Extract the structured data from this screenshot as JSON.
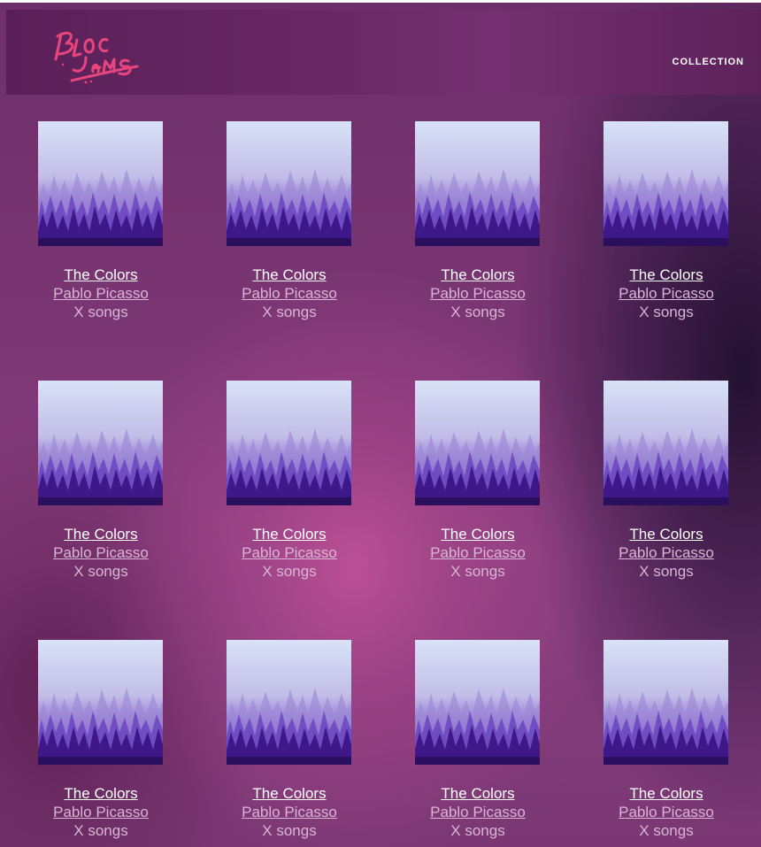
{
  "app": {
    "brand": "Bloc Jams",
    "accent_color": "#e0447a",
    "background_color": "#7b3674"
  },
  "navbar": {
    "logo_text": "Bloc Jams",
    "links": [
      {
        "label": "COLLECTION"
      }
    ]
  },
  "collection": {
    "albums": [
      {
        "title": "The Colors",
        "artist": "Pablo Picasso",
        "song_count": "X songs",
        "cover_icon": "album-cover-forest"
      },
      {
        "title": "The Colors",
        "artist": "Pablo Picasso",
        "song_count": "X songs",
        "cover_icon": "album-cover-forest"
      },
      {
        "title": "The Colors",
        "artist": "Pablo Picasso",
        "song_count": "X songs",
        "cover_icon": "album-cover-forest"
      },
      {
        "title": "The Colors",
        "artist": "Pablo Picasso",
        "song_count": "X songs",
        "cover_icon": "album-cover-forest"
      },
      {
        "title": "The Colors",
        "artist": "Pablo Picasso",
        "song_count": "X songs",
        "cover_icon": "album-cover-forest"
      },
      {
        "title": "The Colors",
        "artist": "Pablo Picasso",
        "song_count": "X songs",
        "cover_icon": "album-cover-forest"
      },
      {
        "title": "The Colors",
        "artist": "Pablo Picasso",
        "song_count": "X songs",
        "cover_icon": "album-cover-forest"
      },
      {
        "title": "The Colors",
        "artist": "Pablo Picasso",
        "song_count": "X songs",
        "cover_icon": "album-cover-forest"
      },
      {
        "title": "The Colors",
        "artist": "Pablo Picasso",
        "song_count": "X songs",
        "cover_icon": "album-cover-forest"
      },
      {
        "title": "The Colors",
        "artist": "Pablo Picasso",
        "song_count": "X songs",
        "cover_icon": "album-cover-forest"
      },
      {
        "title": "The Colors",
        "artist": "Pablo Picasso",
        "song_count": "X songs",
        "cover_icon": "album-cover-forest"
      },
      {
        "title": "The Colors",
        "artist": "Pablo Picasso",
        "song_count": "X songs",
        "cover_icon": "album-cover-forest"
      }
    ]
  }
}
